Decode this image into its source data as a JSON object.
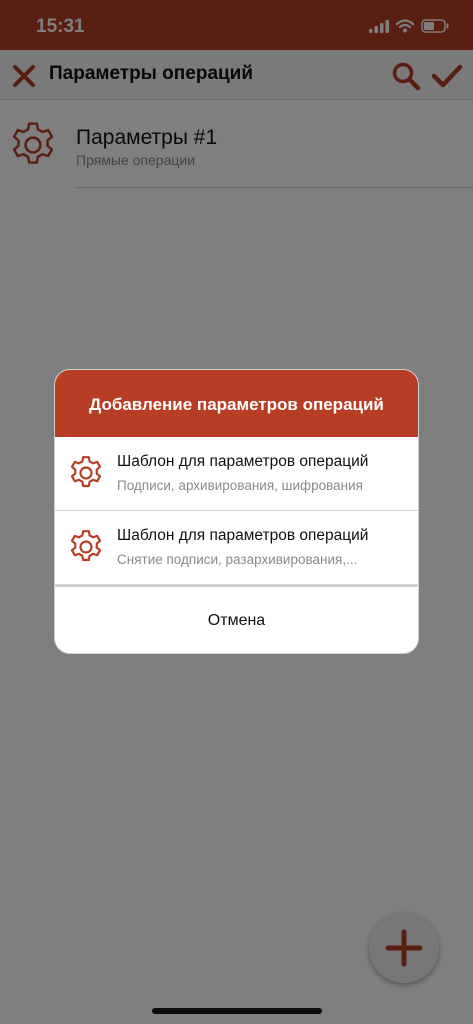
{
  "status": {
    "time": "15:31"
  },
  "appbar": {
    "title": "Параметры операций"
  },
  "list": {
    "items": [
      {
        "name": "Параметры #1",
        "subtitle": "Прямые операции"
      }
    ]
  },
  "dialog": {
    "title": "Добавление параметров операций",
    "options": [
      {
        "title": "Шаблон для параметров операций",
        "subtitle": "Подписи, архивирования, шифрования"
      },
      {
        "title": "Шаблон для параметров операций",
        "subtitle": "Снятие подписи, разархивирования,..."
      }
    ],
    "cancel_label": "Отмена"
  },
  "colors": {
    "accent": "#b73d24",
    "appbar_bg": "#f4f4f4",
    "overlay": "rgba(0,0,0,0.5)"
  },
  "icons": [
    "close-icon",
    "search-icon",
    "checkmark-icon",
    "gear-icon",
    "plus-icon",
    "signal-icon",
    "wifi-icon",
    "battery-icon"
  ]
}
